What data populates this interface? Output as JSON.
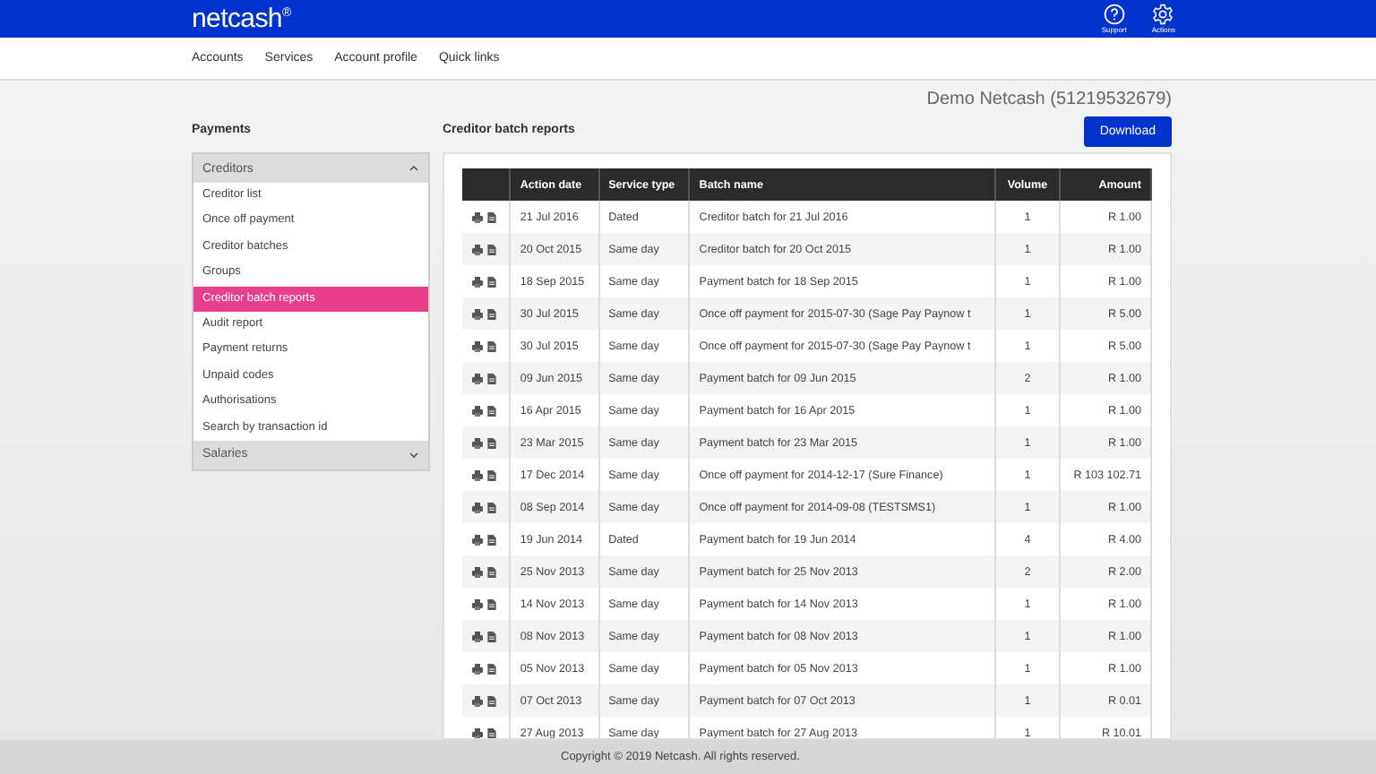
{
  "header": {
    "logo": "netcash",
    "logo_mark": "®",
    "actions": [
      {
        "label": "Support",
        "kind": "help"
      },
      {
        "label": "Actions",
        "kind": "gear"
      }
    ]
  },
  "nav": [
    "Accounts",
    "Services",
    "Account profile",
    "Quick links"
  ],
  "account": "Demo Netcash (51219532679)",
  "download_button": "Download",
  "sidebar": {
    "title": "Payments",
    "sections": [
      {
        "label": "Creditors",
        "expanded": true,
        "items": [
          {
            "label": "Creditor list",
            "selected": false
          },
          {
            "label": "Once off payment",
            "selected": false
          },
          {
            "label": "Creditor batches",
            "selected": false
          },
          {
            "label": "Groups",
            "selected": false
          },
          {
            "label": "Creditor batch reports",
            "selected": true
          },
          {
            "label": "Audit report",
            "selected": false
          },
          {
            "label": "Payment returns",
            "selected": false
          },
          {
            "label": "Unpaid codes",
            "selected": false
          },
          {
            "label": "Authorisations",
            "selected": false
          },
          {
            "label": "Search by transaction id",
            "selected": false
          }
        ]
      },
      {
        "label": "Salaries",
        "expanded": false
      }
    ]
  },
  "report": {
    "title": "Creditor batch reports",
    "columns": [
      "Action date",
      "Service type",
      "Batch name",
      "Volume",
      "Amount"
    ],
    "rows": [
      [
        "21 Jul 2016",
        "Dated",
        "Creditor batch for 21 Jul 2016",
        "1",
        "R 1.00"
      ],
      [
        "20 Oct 2015",
        "Same day",
        "Creditor batch for 20 Oct 2015",
        "1",
        "R 1.00"
      ],
      [
        "18 Sep 2015",
        "Same day",
        "Payment batch for 18 Sep 2015",
        "1",
        "R 1.00"
      ],
      [
        "30 Jul 2015",
        "Same day",
        "Once off payment for 2015-07-30 (Sage Pay Paynow t",
        "1",
        "R 5.00"
      ],
      [
        "30 Jul 2015",
        "Same day",
        "Once off payment for 2015-07-30 (Sage Pay Paynow t",
        "1",
        "R 5.00"
      ],
      [
        "09 Jun 2015",
        "Same day",
        "Payment batch for 09 Jun 2015",
        "2",
        "R 1.00"
      ],
      [
        "16 Apr 2015",
        "Same day",
        "Payment batch for 16 Apr 2015",
        "1",
        "R 1.00"
      ],
      [
        "23 Mar 2015",
        "Same day",
        "Payment batch for 23 Mar 2015",
        "1",
        "R 1.00"
      ],
      [
        "17 Dec 2014",
        "Same day",
        "Once off payment for 2014-12-17 (Sure Finance)",
        "1",
        "R 103 102.71"
      ],
      [
        "08 Sep 2014",
        "Same day",
        "Once off payment for 2014-09-08 (TESTSMS1)",
        "1",
        "R 1.00"
      ],
      [
        "19 Jun 2014",
        "Dated",
        "Payment batch for 19 Jun 2014",
        "4",
        "R 4.00"
      ],
      [
        "25 Nov 2013",
        "Same day",
        "Payment batch for 25 Nov 2013",
        "2",
        "R 2.00"
      ],
      [
        "14 Nov 2013",
        "Same day",
        "Payment batch for 14 Nov 2013",
        "1",
        "R 1.00"
      ],
      [
        "08 Nov 2013",
        "Same day",
        "Payment batch for 08 Nov 2013",
        "1",
        "R 1.00"
      ],
      [
        "05 Nov 2013",
        "Same day",
        "Payment batch for 05 Nov 2013",
        "1",
        "R 1.00"
      ],
      [
        "07 Oct 2013",
        "Same day",
        "Payment batch for 07 Oct 2013",
        "1",
        "R 0.01"
      ],
      [
        "27 Aug 2013",
        "Same day",
        "Payment batch for 27 Aug 2013",
        "1",
        "R 10.01"
      ]
    ]
  },
  "footer": "Copyright © 2019 Netcash. All rights reserved."
}
